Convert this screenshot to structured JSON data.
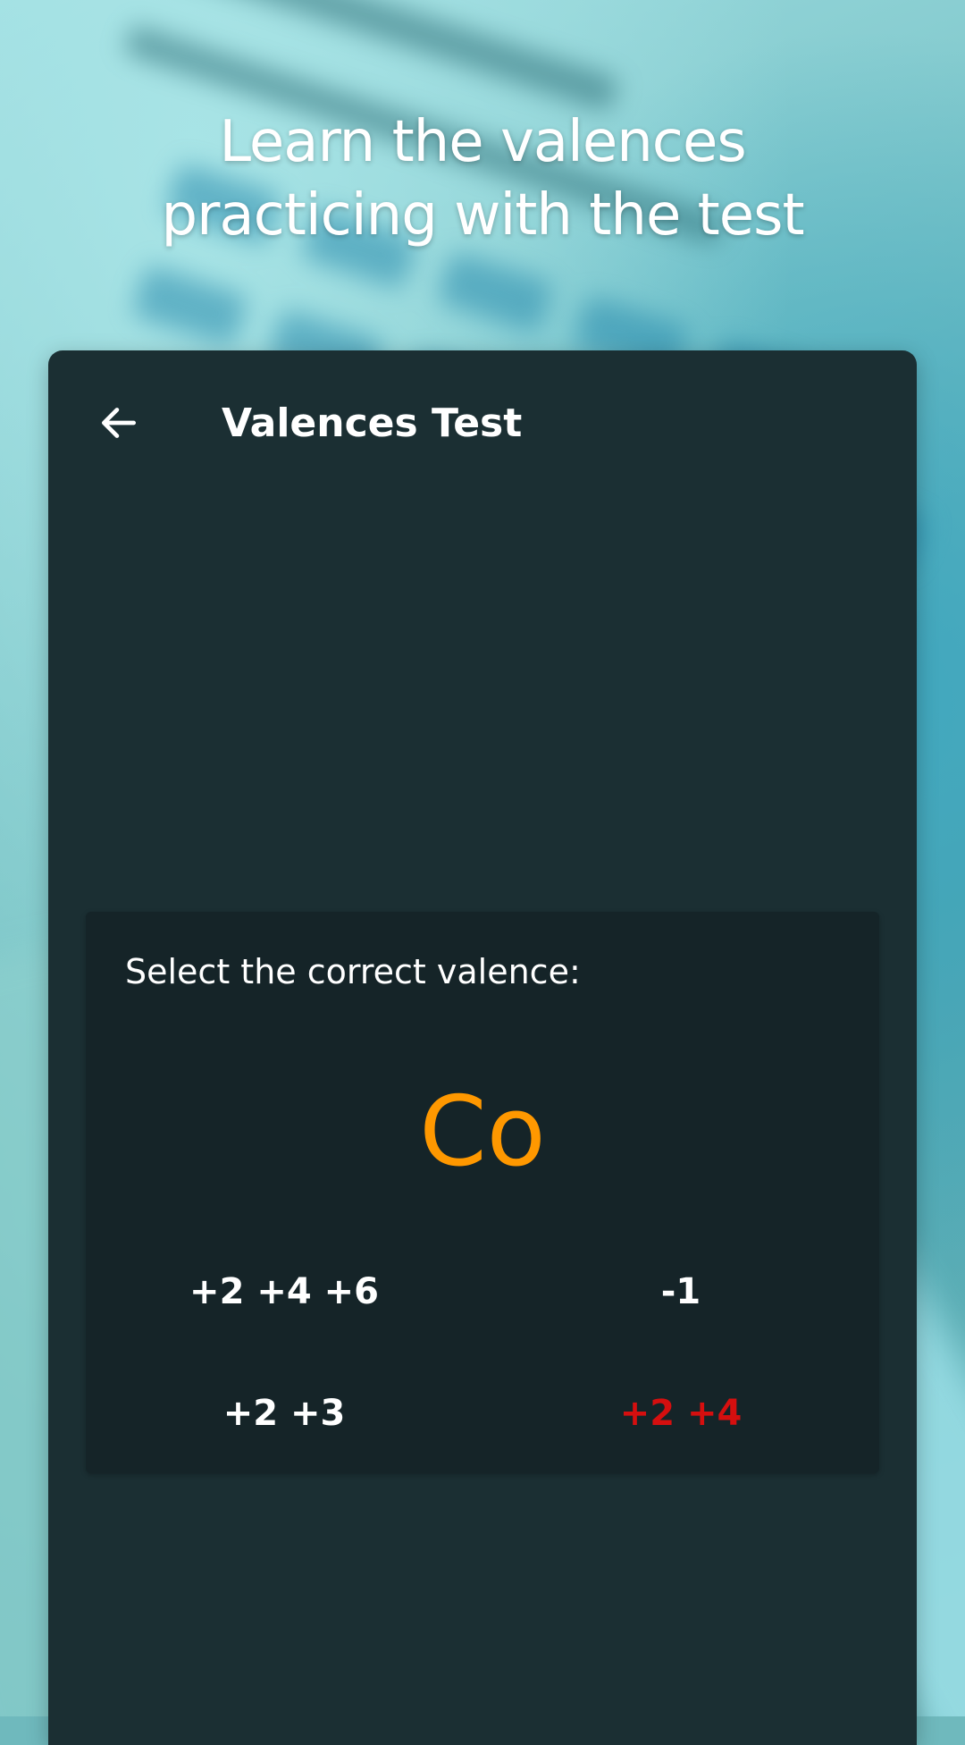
{
  "headline": {
    "line1": "Learn the valences",
    "line2": "practicing with the test"
  },
  "appbar": {
    "back_icon": "arrow-left-icon",
    "title": "Valences Test"
  },
  "quiz": {
    "prompt": "Select the correct valence:",
    "element_symbol": "Co",
    "options": [
      {
        "label": "+2 +4 +6",
        "state": "default"
      },
      {
        "label": "-1",
        "state": "default"
      },
      {
        "label": "+2 +3",
        "state": "default"
      },
      {
        "label": "+2 +4",
        "state": "wrong"
      }
    ]
  },
  "colors": {
    "device_background": "#1b2f33",
    "card_background": "#152428",
    "symbol": "#ff9800",
    "wrong_answer": "#d50f0f",
    "text": "#ffffff"
  }
}
